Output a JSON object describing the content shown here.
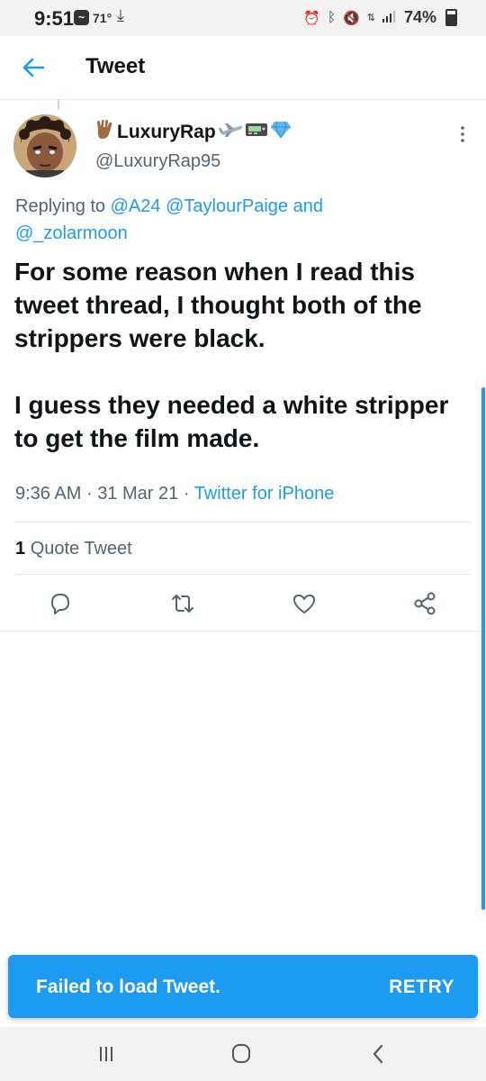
{
  "status_bar": {
    "time": "9:51",
    "temperature": "71°",
    "battery": "74%",
    "icons": [
      "app-notification-icon",
      "download-icon",
      "alarm-icon",
      "bluetooth-icon",
      "mute-icon",
      "data-icon",
      "signal-icon",
      "battery-icon"
    ]
  },
  "header": {
    "title": "Tweet",
    "back_icon": "back-arrow-icon"
  },
  "tweet": {
    "author": {
      "display_name": "LuxuryRap",
      "handle": "@LuxuryRap95",
      "emojis": [
        "vulcan-salute-emoji",
        "airplane-emoji",
        "pager-emoji",
        "gem-emoji"
      ]
    },
    "reply": {
      "prefix": "Replying to",
      "mentions": [
        "@A24",
        "@TaylourPaige",
        "@_zolarmoon"
      ],
      "conjunction": "and"
    },
    "text_paragraphs": [
      "For some reason when I read this tweet thread, I thought both of the strippers were black.",
      "I guess they needed a white stripper to get the film made."
    ],
    "time": "9:36 AM",
    "date": "31 Mar 21",
    "source": "Twitter for iPhone",
    "separator": "·",
    "quote_count": "1",
    "quote_label": "Quote Tweet",
    "actions": [
      "reply-icon",
      "retweet-icon",
      "like-icon",
      "share-icon"
    ]
  },
  "toast": {
    "message": "Failed to load Tweet.",
    "action": "RETRY"
  },
  "nav_bar": {
    "buttons": [
      "recent-apps-icon",
      "home-icon",
      "back-icon"
    ]
  },
  "colors": {
    "accent": "#1d9bf0",
    "text_primary": "#0f1419",
    "text_secondary": "#536471",
    "divider": "#e6ecf0"
  }
}
